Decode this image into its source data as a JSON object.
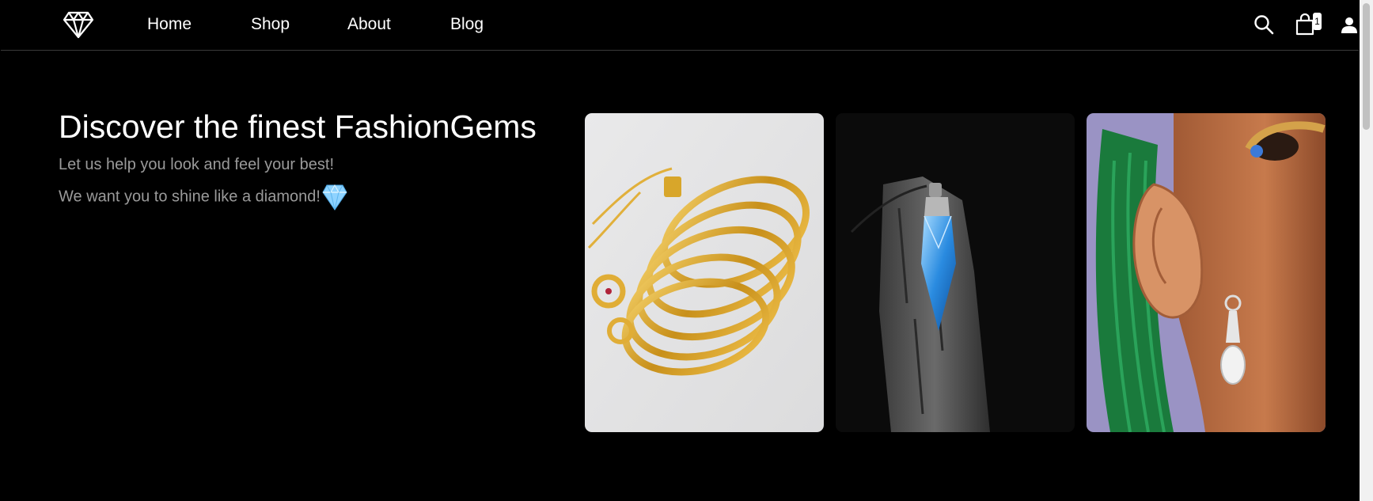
{
  "nav": {
    "items": [
      {
        "label": "Home"
      },
      {
        "label": "Shop"
      },
      {
        "label": "About"
      },
      {
        "label": "Blog"
      }
    ]
  },
  "icons": {
    "logo": "diamond-logo-icon",
    "search": "search-icon",
    "cart": "shopping-bag-icon",
    "user": "user-icon"
  },
  "cart": {
    "count": "1"
  },
  "hero": {
    "title": "Discover the finest FashionGems",
    "line1": "Let us help you look and feel your best!",
    "line2": "We want you to shine like a diamond!"
  },
  "colors": {
    "background": "#000000",
    "text": "#ffffff",
    "subtext": "#9a9a9a",
    "gem": "#8fd3ff"
  }
}
